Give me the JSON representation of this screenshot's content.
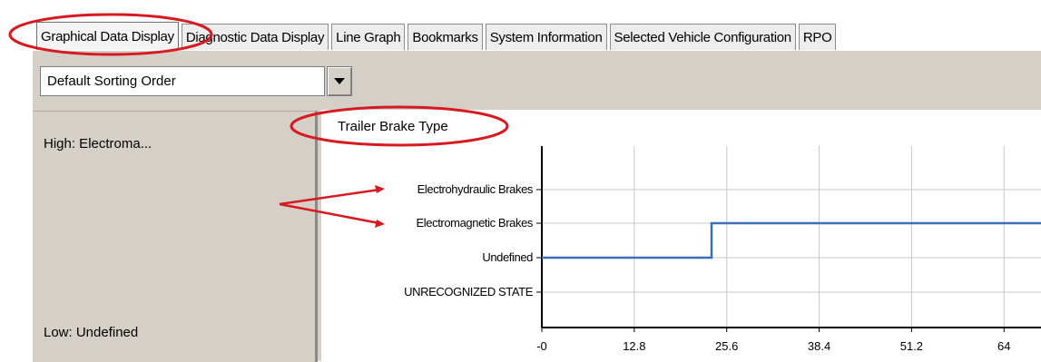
{
  "tabs": [
    {
      "label": "Graphical Data Display",
      "active": true
    },
    {
      "label": "Diagnostic Data Display",
      "active": false
    },
    {
      "label": "Line Graph",
      "active": false
    },
    {
      "label": "Bookmarks",
      "active": false
    },
    {
      "label": "System Information",
      "active": false
    },
    {
      "label": "Selected Vehicle Configuration",
      "active": false
    },
    {
      "label": "RPO",
      "active": false
    }
  ],
  "sort": {
    "selected": "Default Sorting Order",
    "icon": "chevron-down-icon"
  },
  "left_panel": {
    "high": "High:  Electroma...",
    "low": "Low:  Undefined"
  },
  "colors": {
    "annotation": "#d71920",
    "series": "#3d6fb6",
    "panel": "#d4d0c8"
  },
  "chart_data": {
    "type": "line",
    "title": "Trailer Brake Type",
    "y_categories": [
      "UNRECOGNIZED STATE",
      "Undefined",
      "Electromagnetic Brakes",
      "Electrohydraulic Brakes"
    ],
    "x_ticks": [
      "-0",
      "12.8",
      "25.6",
      "38.4",
      "51.2",
      "64"
    ],
    "xlim": [
      0,
      70
    ],
    "grid": true,
    "series": [
      {
        "points": [
          {
            "x": 0,
            "y": "Undefined"
          },
          {
            "x": 23.5,
            "y": "Undefined"
          },
          {
            "x": 23.5,
            "y": "Electromagnetic Brakes"
          },
          {
            "x": 70,
            "y": "Electromagnetic Brakes"
          }
        ]
      }
    ]
  }
}
